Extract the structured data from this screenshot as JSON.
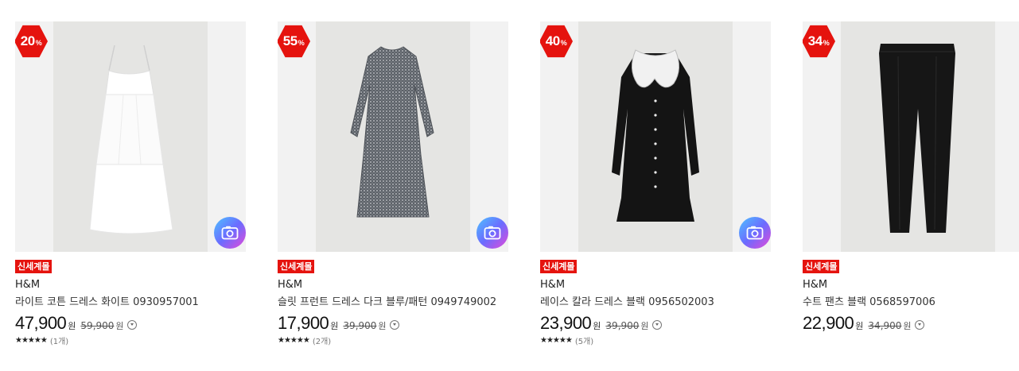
{
  "products": [
    {
      "discount": "20",
      "pct_symbol": "%",
      "tag": "신세계몰",
      "brand": "H&M",
      "name": "라이트 코튼 드레스 화이트 0930957001",
      "price": "47,900",
      "currency": "원",
      "original_price": "59,900",
      "stars": "★★★★★",
      "rating_value": 5,
      "review_count": "(1개)",
      "image_subject": "white cotton maxi dress",
      "has_camera_button": true
    },
    {
      "discount": "55",
      "pct_symbol": "%",
      "tag": "신세계몰",
      "brand": "H&M",
      "name": "슬릿 프런트 드레스 다크 블루/패턴 0949749002",
      "price": "17,900",
      "currency": "원",
      "original_price": "39,900",
      "stars": "★★★★★",
      "rating_value": 4.5,
      "review_count": "(2개)",
      "image_subject": "dark blue patterned long-sleeve maxi dress",
      "has_camera_button": true
    },
    {
      "discount": "40",
      "pct_symbol": "%",
      "tag": "신세계몰",
      "brand": "H&M",
      "name": "레이스 칼라 드레스 블랙 0956502003",
      "price": "23,900",
      "currency": "원",
      "original_price": "39,900",
      "stars": "★★★★★",
      "rating_value": 4.5,
      "review_count": "(5개)",
      "image_subject": "black dress with white lace collar",
      "has_camera_button": true
    },
    {
      "discount": "34",
      "pct_symbol": "%",
      "tag": "신세계몰",
      "brand": "H&M",
      "name": "수트 팬츠 블랙 0568597006",
      "price": "22,900",
      "currency": "원",
      "original_price": "34,900",
      "image_subject": "black suit trousers",
      "has_camera_button": false
    }
  ],
  "colors": {
    "badge": "#e5130e",
    "tag": "#e5130e",
    "camera_gradient": [
      "#4dc2ff",
      "#6b6cff",
      "#e449d8"
    ]
  },
  "icons": {
    "camera": "camera-search-icon",
    "info": "info-circle-icon"
  }
}
